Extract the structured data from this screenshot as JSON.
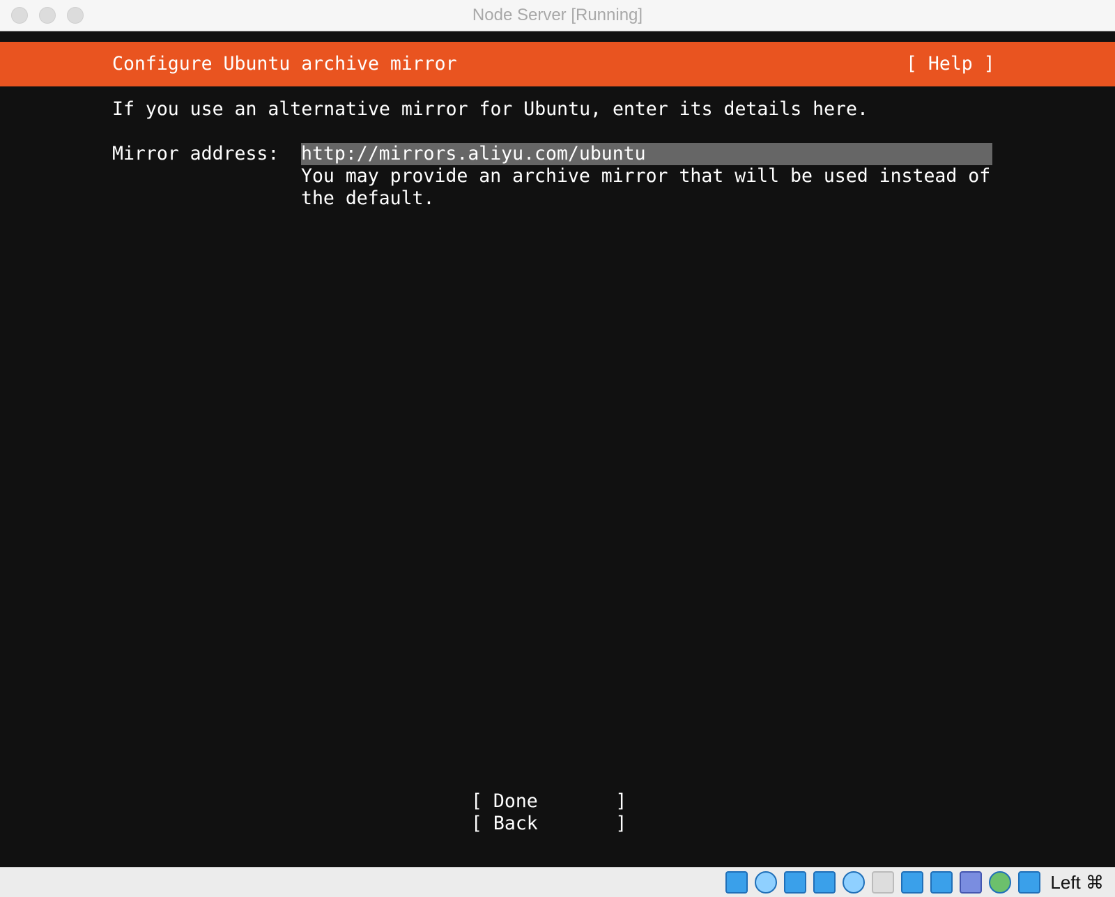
{
  "window": {
    "title": "Node Server [Running]"
  },
  "installer": {
    "header_title": "Configure Ubuntu archive mirror",
    "help_label": "[ Help ]",
    "intro": "If you use an alternative mirror for Ubuntu, enter its details here.",
    "mirror_label": "Mirror address:",
    "mirror_value": "http://mirrors.aliyu.com/ubuntu",
    "hint_line1": "You may provide an archive mirror that will be used instead of",
    "hint_line2": "the default.",
    "done_label": "[ Done       ]",
    "back_label": "[ Back       ]"
  },
  "colors": {
    "header": "#e95420",
    "background": "#111111",
    "field": "#666666"
  },
  "statusbar": {
    "icons": [
      "hard-disk-icon",
      "optical-disk-icon",
      "audio-icon",
      "network-icon",
      "usb-icon",
      "shared-folder-icon",
      "display-icon",
      "video-capture-icon",
      "cpu-icon",
      "mouse-integration-icon",
      "keyboard-capture-icon"
    ],
    "host_key": "Left ⌘"
  }
}
